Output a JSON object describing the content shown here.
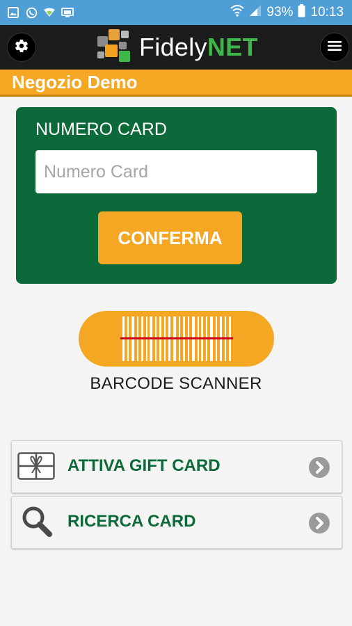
{
  "status_bar": {
    "battery_percent": "93%",
    "time": "10:13",
    "icons": [
      "gallery-icon",
      "whatsapp-icon",
      "wifi-signal-icon",
      "screen-icon",
      "wifi-icon",
      "cell-signal-icon",
      "battery-icon"
    ]
  },
  "app_bar": {
    "logo_prefix": "Fidely",
    "logo_suffix": "NET",
    "left_icon": "gear-icon",
    "right_icon": "hamburger-menu-icon"
  },
  "store": {
    "name": "Negozio Demo"
  },
  "card_form": {
    "label": "NUMERO CARD",
    "placeholder": "Numero Card",
    "value": "",
    "confirm_label": "CONFERMA"
  },
  "scanner": {
    "label": "BARCODE SCANNER",
    "icon": "barcode-icon"
  },
  "menu": [
    {
      "label": "ATTIVA GIFT CARD",
      "icon": "gift-card-icon"
    },
    {
      "label": "RICERCA CARD",
      "icon": "magnifier-icon"
    }
  ],
  "colors": {
    "status_bar": "#4f9fd6",
    "app_bar": "#1c1c1c",
    "accent_orange": "#f5a623",
    "brand_green": "#0c6a3a",
    "logo_green": "#3db64a"
  }
}
